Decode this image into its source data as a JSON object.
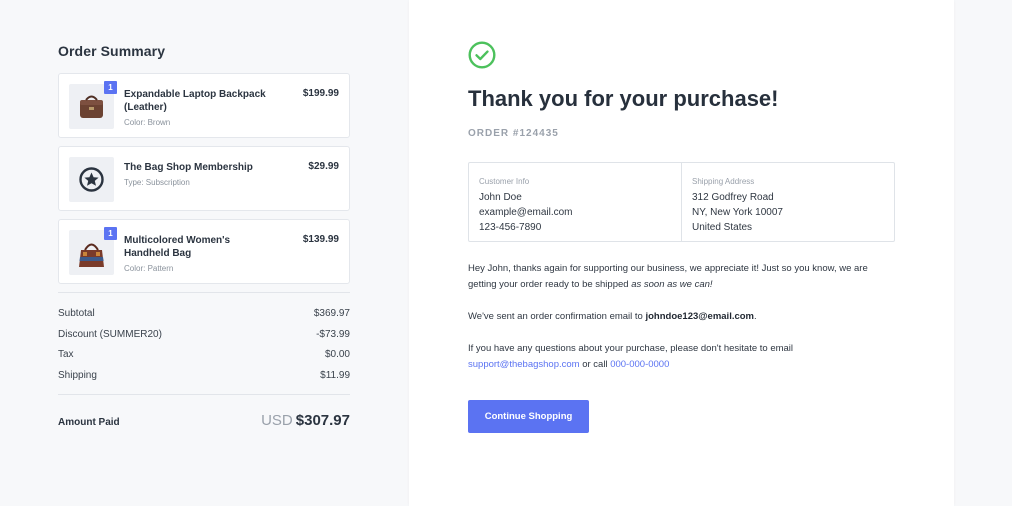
{
  "summary": {
    "title": "Order Summary",
    "items": [
      {
        "name": "Expandable Laptop Backpack (Leather)",
        "meta": "Color: Brown",
        "price": "$199.99",
        "qty": "1",
        "icon": "backpack-image"
      },
      {
        "name": "The Bag Shop Membership",
        "meta": "Type: Subscription",
        "price": "$29.99",
        "icon": "star-icon"
      },
      {
        "name": "Multicolored Women's Handheld Bag",
        "meta": "Color: Pattern",
        "price": "$139.99",
        "qty": "1",
        "icon": "handbag-image"
      }
    ],
    "totals": [
      {
        "label": "Subtotal",
        "value": "$369.97"
      },
      {
        "label": "Discount (SUMMER20)",
        "value": "-$73.99"
      },
      {
        "label": "Tax",
        "value": "$0.00"
      },
      {
        "label": "Shipping",
        "value": "$11.99"
      }
    ],
    "paid": {
      "label": "Amount Paid",
      "currency": "USD",
      "amount": "$307.97"
    }
  },
  "confirmation": {
    "icon": "check-circle-icon",
    "title": "Thank you for your purchase!",
    "order_number": "ORDER #124435",
    "customer": {
      "label": "Customer Info",
      "name": "John Doe",
      "email": "example@email.com",
      "phone": "123-456-7890"
    },
    "shipping": {
      "label": "Shipping Address",
      "line1": "312 Godfrey Road",
      "line2": "NY, New York 10007",
      "line3": "United States"
    },
    "message1_a": "Hey John, thanks again for supporting our business, we appreciate it! Just so you know, we are getting your order ready to be shipped ",
    "message1_b": "as soon as we can!",
    "message2_a": "We've sent an order confirmation email to ",
    "message2_email": "johndoe123@email.com",
    "message2_b": ".",
    "message3_a": "If you have any questions about your purchase, please don't hesitate to email ",
    "support_email": "support@thebagshop.com",
    "message3_b": " or call ",
    "support_phone": "000-000-0000",
    "button_label": "Continue Shopping"
  },
  "colors": {
    "accent": "#5b73f2",
    "success": "#4cc15c"
  }
}
